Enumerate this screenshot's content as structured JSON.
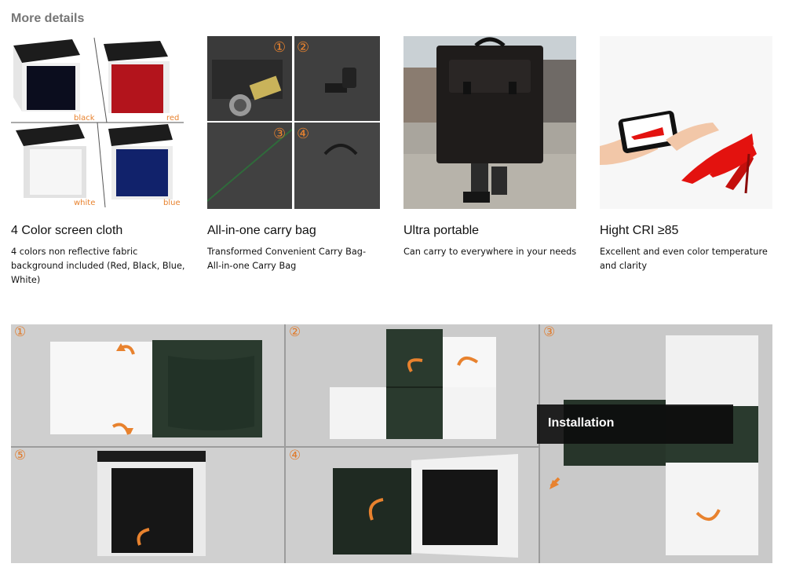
{
  "section": {
    "title": "More details"
  },
  "features": [
    {
      "title": "4 Color screen cloth",
      "description": "4 colors non reflective fabric background included (Red, Black, Blue, White)",
      "labels": [
        "black",
        "red",
        "white",
        "blue"
      ]
    },
    {
      "title": "All-in-one carry bag",
      "description": "Transformed Convenient Carry Bag- All-in-one Carry Bag",
      "labels": [
        "①",
        "②",
        "③",
        "④"
      ]
    },
    {
      "title": "Ultra portable",
      "description": "Can carry to everywhere in your needs"
    },
    {
      "title": "Hight CRI ≥85",
      "description": "Excellent and even color temperature and clarity"
    }
  ],
  "installation": {
    "label": "Installation",
    "steps": [
      "①",
      "②",
      "③",
      "④",
      "⑤"
    ]
  },
  "colors": {
    "accent_orange": "#e8822e",
    "swatch_black": "#0b0d1e",
    "swatch_red": "#b3141c",
    "swatch_white": "#f2f2f2",
    "swatch_blue": "#11226b",
    "shoe_red": "#e3120f"
  }
}
